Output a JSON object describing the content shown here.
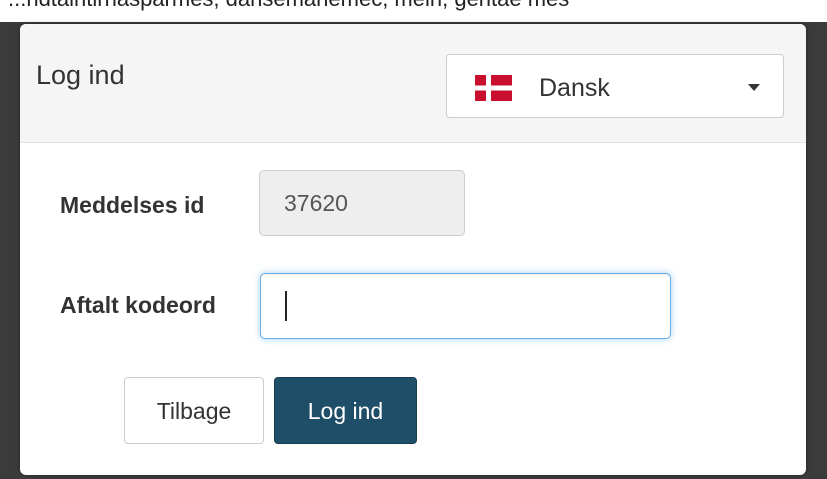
{
  "top_strip_text": "...ndtaintirnasparmes, dansemanemec, mein, gentae mes",
  "dialog": {
    "title": "Log ind",
    "language": {
      "selected": "Dansk",
      "flag_icon": "denmark-flag-icon"
    },
    "fields": {
      "message_id_label": "Meddelses id",
      "message_id_value": "37620",
      "password_label": "Aftalt kodeord",
      "password_value": ""
    },
    "buttons": {
      "back_label": "Tilbage",
      "login_label": "Log ind"
    }
  },
  "colors": {
    "primary_button": "#1f4e68",
    "focus_border": "#66afe9",
    "flag_red": "#c8102e"
  }
}
